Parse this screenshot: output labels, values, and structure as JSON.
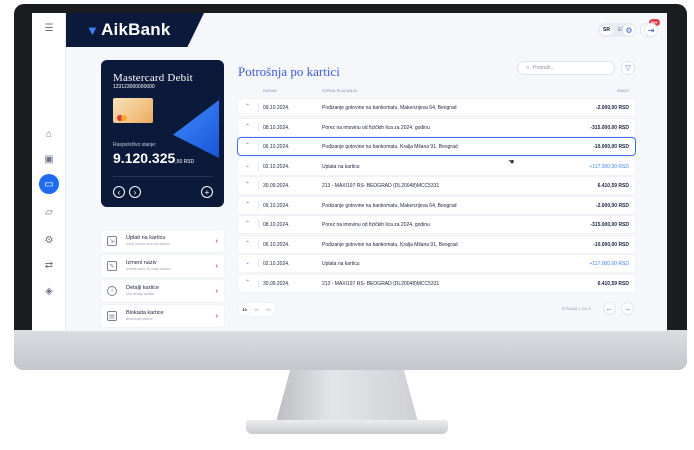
{
  "header": {
    "brand": "AikBank",
    "lang_sr": "SR",
    "lang_en": "EN",
    "notif_badge": "99+"
  },
  "card": {
    "title": "Mastercard Debit",
    "number": "123123000000000",
    "balance_label": "Raspoloživo stanje:",
    "balance_main": "9.120.325",
    "balance_suffix": ",50 RSD"
  },
  "actions": [
    {
      "label": "Uplati na karticu",
      "sub": "Izvrši uplatu na svoju karticu"
    },
    {
      "label": "Izmeni naziv",
      "sub": "Izmeni naziv za svoju karticu"
    },
    {
      "label": "Detalji kartice",
      "sub": "Vidi detalje kartice"
    },
    {
      "label": "Blokada kartice",
      "sub": "Blokiranje kartice"
    }
  ],
  "page": {
    "title": "Potrošnja po kartici",
    "search_placeholder": "Pretraži...",
    "col_date": "DATUM",
    "col_desc": "SVRHA PLAĆANJA",
    "col_amount": "IZNOS"
  },
  "transactions": [
    {
      "date": "09.10.2024.",
      "desc": "Podizanje gotovine na bankomatu, Makenzijeva 64, Beograd",
      "amount": "-2.000,00 RSD",
      "positive": false
    },
    {
      "date": "08.10.2024.",
      "desc": "Porez na imovinu od fizičkih lica za 2024. godinu",
      "amount": "-315.000,00 RSD",
      "positive": false
    },
    {
      "date": "06.10.2024.",
      "desc": "Podizanje gotovine na bankomatu, Kralja Milana 91, Beograd",
      "amount": "-10.000,00 RSD",
      "positive": false
    },
    {
      "date": "02.10.2024.",
      "desc": "Uplata na karticu",
      "amount": "+117.000,00 RSD",
      "positive": true
    },
    {
      "date": "30.09.2024.",
      "desc": "213 - MAXI197 RS- BEOGRAD (DL20048)MCC5331",
      "amount": "6.410,59 RSD",
      "positive": false
    },
    {
      "date": "09.10.2024.",
      "desc": "Podizanje gotovine na bankomatu, Makenzijeva 64, Beograd",
      "amount": "-2.000,00 RSD",
      "positive": false
    },
    {
      "date": "08.10.2024.",
      "desc": "Porez na imovinu od fizičkih lica za 2024. godinu",
      "amount": "-315.000,00 RSD",
      "positive": false
    },
    {
      "date": "06.10.2024.",
      "desc": "Podizanje gotovine na bankomatu, Kralja Milana 91, Beograd",
      "amount": "-10.000,00 RSD",
      "positive": false
    },
    {
      "date": "02.10.2024.",
      "desc": "Uplata na karticu",
      "amount": "+117.000,00 RSD",
      "positive": true
    },
    {
      "date": "30.09.2024.",
      "desc": "213 - MAXI197 RS- BEOGRAD (DL20048)MCC5331",
      "amount": "6.410,59 RSD",
      "positive": false
    }
  ],
  "pagination": {
    "sizes": [
      "10",
      "20",
      "50"
    ],
    "info": "STRANA 1 OD 5"
  },
  "colors": {
    "navy": "#0b1a3a",
    "accent": "#3b6ef3",
    "danger": "#e23b4a"
  }
}
